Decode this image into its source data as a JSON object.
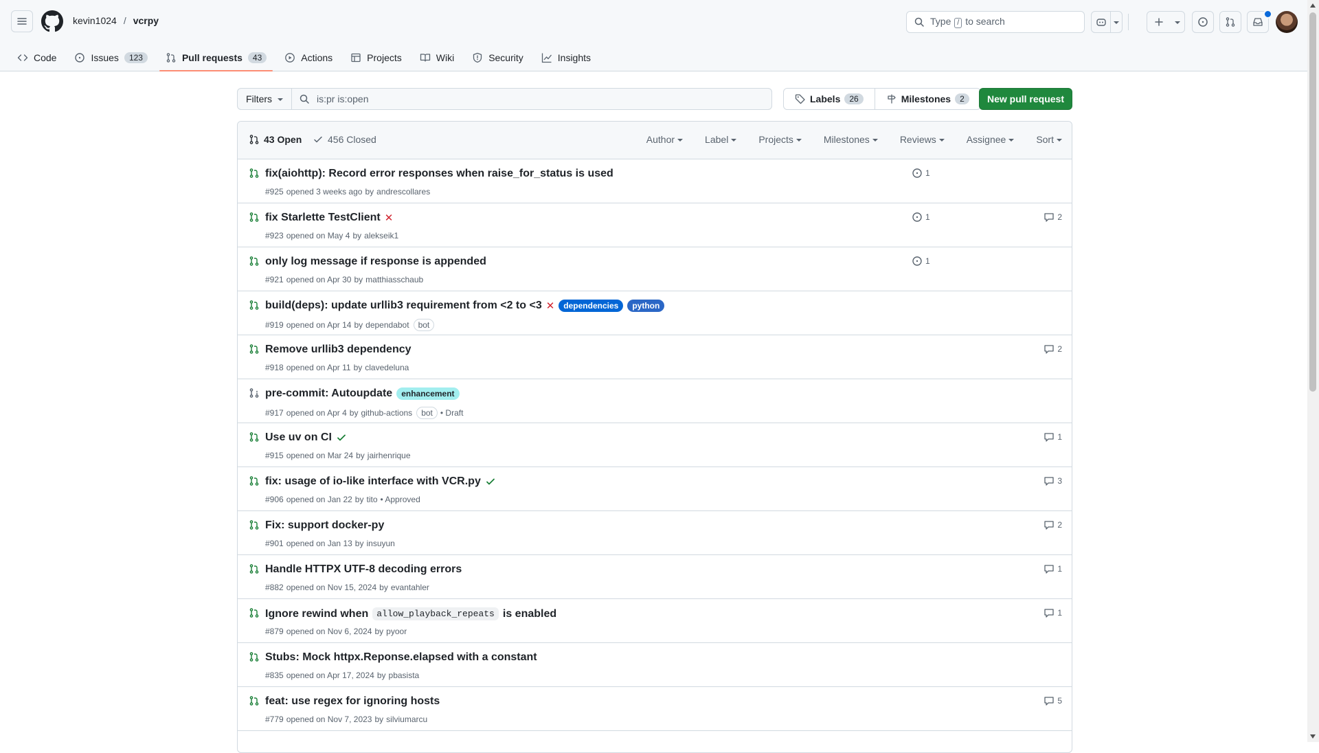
{
  "header": {
    "owner": "kevin1024",
    "separator": "/",
    "repo": "vcrpy",
    "search_prefix": "Type",
    "search_key": "/",
    "search_suffix": "to search"
  },
  "tabs": [
    {
      "label": "Code",
      "icon": "code-icon"
    },
    {
      "label": "Issues",
      "icon": "issue-icon",
      "count": "123"
    },
    {
      "label": "Pull requests",
      "icon": "pull-request-icon",
      "count": "43",
      "selected": true
    },
    {
      "label": "Actions",
      "icon": "play-icon"
    },
    {
      "label": "Projects",
      "icon": "table-icon"
    },
    {
      "label": "Wiki",
      "icon": "book-icon"
    },
    {
      "label": "Security",
      "icon": "shield-icon"
    },
    {
      "label": "Insights",
      "icon": "graph-icon"
    }
  ],
  "subnav": {
    "filters_label": "Filters",
    "query": "is:pr is:open",
    "labels_label": "Labels",
    "labels_count": "26",
    "milestones_label": "Milestones",
    "milestones_count": "2",
    "new_pr_label": "New pull request"
  },
  "list": {
    "open_label": "43 Open",
    "closed_label": "456 Closed",
    "facets": [
      "Author",
      "Label",
      "Projects",
      "Milestones",
      "Reviews",
      "Assignee",
      "Sort"
    ]
  },
  "colors": {
    "accent": "#0969da",
    "open_green": "#1a7f37",
    "button_green": "#1f883d",
    "fail_red": "#d1242f",
    "tab_underline": "#fd8c73",
    "label_dependencies": "#0366d6",
    "label_python": "#2b67c6",
    "label_enhancement": "#a2eeef"
  },
  "pull_requests": [
    {
      "title": "fix(aiohttp): Record error responses when raise_for_status is used",
      "number": "#925",
      "when": "opened 3 weeks ago",
      "author": "andrescollares",
      "linked": "1"
    },
    {
      "title": "fix Starlette TestClient",
      "status": "fail",
      "number": "#923",
      "when": "opened on May 4",
      "author": "alekseik1",
      "linked": "1",
      "comments": "2"
    },
    {
      "title": "only log message if response is appended",
      "number": "#921",
      "when": "opened on Apr 30",
      "author": "matthiasschaub",
      "linked": "1"
    },
    {
      "title": "build(deps): update urllib3 requirement from <2 to <3",
      "status": "fail",
      "labels": [
        {
          "text": "dependencies",
          "bg": "#0366d6",
          "fg": "#ffffff"
        },
        {
          "text": "python",
          "bg": "#2b67c6",
          "fg": "#ffffff"
        }
      ],
      "number": "#919",
      "when": "opened on Apr 14",
      "author": "dependabot",
      "bot": "bot"
    },
    {
      "title": "Remove urllib3 dependency",
      "number": "#918",
      "when": "opened on Apr 11",
      "author": "clavedeluna",
      "comments": "2"
    },
    {
      "title": "pre-commit: Autoupdate",
      "draft": true,
      "labels": [
        {
          "text": "enhancement",
          "bg": "#a2eeef",
          "fg": "#1f2328"
        }
      ],
      "number": "#917",
      "when": "opened on Apr 4",
      "author": "github-actions",
      "bot": "bot",
      "extra": "• Draft"
    },
    {
      "title": "Use uv on CI",
      "status": "success",
      "number": "#915",
      "when": "opened on Mar 24",
      "author": "jairhenrique",
      "comments": "1"
    },
    {
      "title": "fix: usage of io-like interface with VCR.py",
      "status": "success",
      "number": "#906",
      "when": "opened on Jan 22",
      "author": "tito",
      "extra": "• Approved",
      "comments": "3"
    },
    {
      "title": "Fix: support docker-py",
      "number": "#901",
      "when": "opened on Jan 13",
      "author": "insuyun",
      "comments": "2"
    },
    {
      "title": "Handle HTTPX UTF-8 decoding errors",
      "number": "#882",
      "when": "opened on Nov 15, 2024",
      "author": "evantahler",
      "comments": "1"
    },
    {
      "title_pre": "Ignore rewind when",
      "title_code": "allow_playback_repeats",
      "title_post": "is enabled",
      "number": "#879",
      "when": "opened on Nov 6, 2024",
      "author": "pyoor",
      "comments": "1"
    },
    {
      "title": "Stubs: Mock httpx.Reponse.elapsed with a constant",
      "number": "#835",
      "when": "opened on Apr 17, 2024",
      "author": "pbasista"
    },
    {
      "title": "feat: use regex for ignoring hosts",
      "number": "#779",
      "when": "opened on Nov 7, 2023",
      "author": "silviumarcu",
      "comments": "5"
    }
  ],
  "words": {
    "by": "by"
  }
}
